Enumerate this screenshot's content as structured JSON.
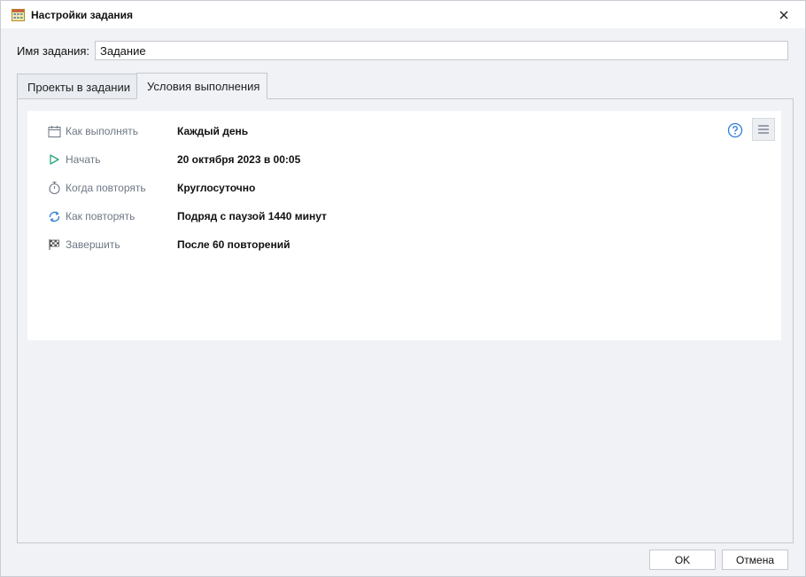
{
  "window": {
    "title": "Настройки задания",
    "app_icon": "calendar-grid-icon",
    "close_icon": "close-icon"
  },
  "task_name": {
    "label": "Имя задания:",
    "value": "Задание"
  },
  "tabs": [
    {
      "label": "Проекты в задании",
      "active": false
    },
    {
      "label": "Условия выполнения",
      "active": true
    }
  ],
  "conditions": [
    {
      "icon": "calendar-icon",
      "label": "Как выполнять",
      "value": "Каждый день"
    },
    {
      "icon": "play-icon",
      "label": "Начать",
      "value": "20 октября 2023 в 00:05"
    },
    {
      "icon": "stopwatch-icon",
      "label": "Когда повторять",
      "value": "Круглосуточно"
    },
    {
      "icon": "repeat-icon",
      "label": "Как повторять",
      "value": "Подряд с паузой 1440 минут"
    },
    {
      "icon": "checkered-flag-icon",
      "label": "Завершить",
      "value": "После 60 повторений"
    }
  ],
  "toolbar": {
    "help_icon": "help-circle-icon",
    "menu_icon": "hamburger-menu-icon"
  },
  "buttons": {
    "ok": "OK",
    "cancel": "Отмена"
  },
  "colors": {
    "accent": "#2e7cd6",
    "play_green": "#2aa57a",
    "label_gray": "#6e7785"
  }
}
